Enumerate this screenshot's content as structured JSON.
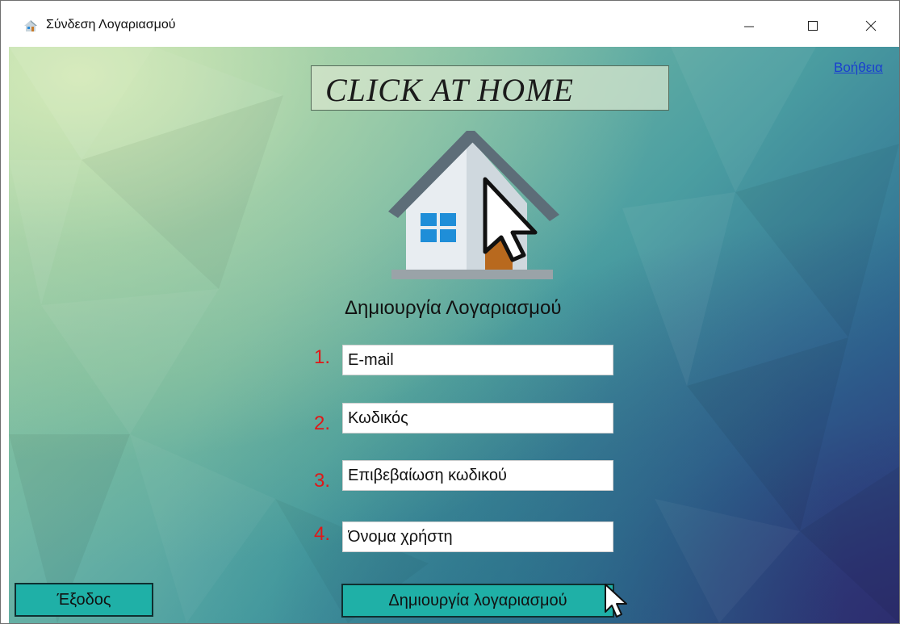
{
  "window": {
    "title": "Σύνδεση Λογαριασμού"
  },
  "help_link": "Βοήθεια",
  "logo_text": "CLICK AT HOME",
  "form": {
    "title": "Δημιουργία Λογαριασμού",
    "fields": [
      {
        "number": "1.",
        "value": "E-mail"
      },
      {
        "number": "2.",
        "value": "Κωδικός"
      },
      {
        "number": "3.",
        "value": "Επιβεβαίωση κωδικού"
      },
      {
        "number": "4.",
        "value": "Όνομα χρήστη"
      }
    ]
  },
  "buttons": {
    "exit": "Έξοδος",
    "create": "Δημιουργία λογαριασμού"
  },
  "icons": [
    "home-icon",
    "minimize-icon",
    "maximize-icon",
    "close-icon",
    "house-logo-icon",
    "mouse-pointer-icon"
  ],
  "colors": {
    "button_bg": "#1fb0a7",
    "number_red": "#e01818",
    "link_blue": "#1a3fcf"
  }
}
